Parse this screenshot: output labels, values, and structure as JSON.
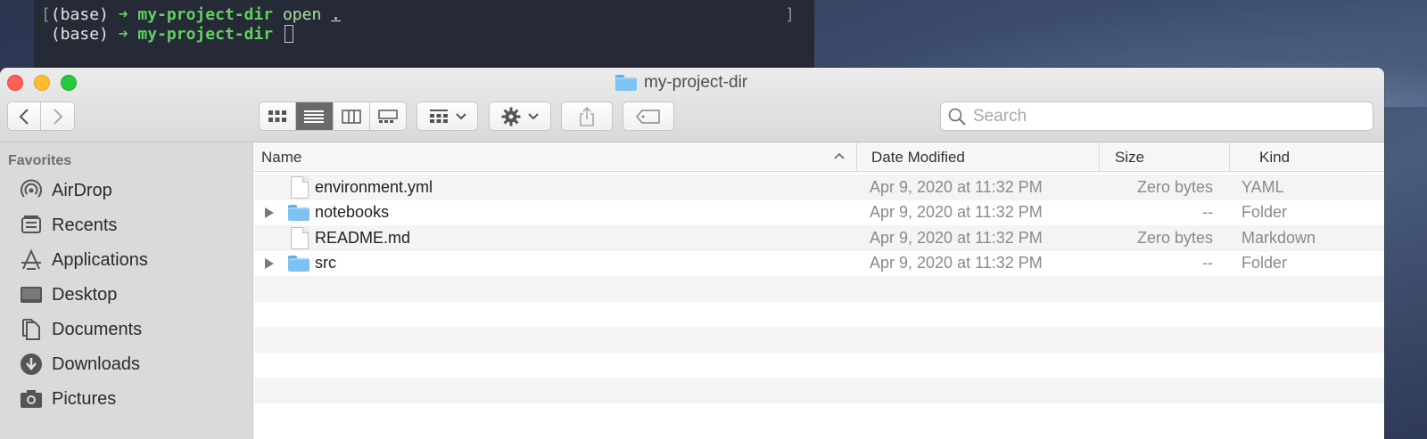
{
  "terminal": {
    "line1": {
      "prompt": "(base)",
      "arrow": "➜",
      "dir": "my-project-dir",
      "cmd": "open",
      "arg": "."
    },
    "line2": {
      "prompt": "(base)",
      "arrow": "➜",
      "dir": "my-project-dir"
    }
  },
  "window": {
    "title": "my-project-dir",
    "toolbar": {
      "search_placeholder": "Search"
    }
  },
  "sidebar": {
    "heading": "Favorites",
    "items": [
      {
        "label": "AirDrop",
        "icon": "airdrop-icon"
      },
      {
        "label": "Recents",
        "icon": "recents-icon"
      },
      {
        "label": "Applications",
        "icon": "applications-icon"
      },
      {
        "label": "Desktop",
        "icon": "desktop-icon"
      },
      {
        "label": "Documents",
        "icon": "documents-icon"
      },
      {
        "label": "Downloads",
        "icon": "downloads-icon"
      },
      {
        "label": "Pictures",
        "icon": "pictures-icon"
      }
    ]
  },
  "list": {
    "columns": {
      "name": "Name",
      "date": "Date Modified",
      "size": "Size",
      "kind": "Kind"
    },
    "rows": [
      {
        "name": "environment.yml",
        "date": "Apr 9, 2020 at 11:32 PM",
        "size": "Zero bytes",
        "kind": "YAML",
        "type": "file"
      },
      {
        "name": "notebooks",
        "date": "Apr 9, 2020 at 11:32 PM",
        "size": "--",
        "kind": "Folder",
        "type": "folder"
      },
      {
        "name": "README.md",
        "date": "Apr 9, 2020 at 11:32 PM",
        "size": "Zero bytes",
        "kind": "Markdown",
        "type": "file"
      },
      {
        "name": "src",
        "date": "Apr 9, 2020 at 11:32 PM",
        "size": "--",
        "kind": "Folder",
        "type": "folder"
      }
    ]
  },
  "colors": {
    "folder": "#7cc3f3",
    "close": "#ff5f57",
    "minimize": "#febc2e",
    "zoom": "#28c840",
    "terminal_green": "#5fd35f"
  }
}
